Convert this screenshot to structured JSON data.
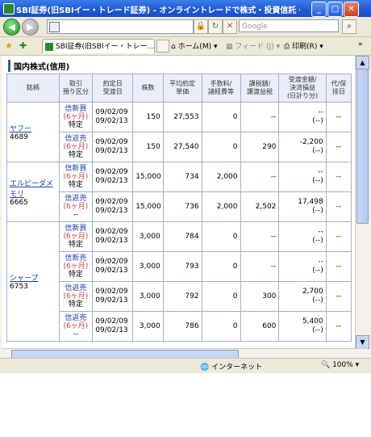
{
  "window": {
    "title": "SBI証券(旧SBIイー・トレード証券) - オンライントレードで株式・投資信託・債券を - - Wi...",
    "min": "_",
    "max": "□",
    "close": "✕"
  },
  "nav": {
    "back": "◀",
    "forward": "▶",
    "address_value": "",
    "search_placeholder": "Google"
  },
  "tab": {
    "label": "SBI証券(旧SBIイー・トレー..."
  },
  "toolbar": {
    "home": "ホーム(M)",
    "feed": "フィード (J)",
    "print": "印刷(R)"
  },
  "section_title": "国内株式(信用)",
  "table": {
    "headers": {
      "name": "銘柄",
      "trade": "取引\n預り区分",
      "date": "約定日\n受渡日",
      "qty": "株数",
      "price": "平均約定\n単価",
      "fee": "手数料/\n諸経費等",
      "tax": "課税額/\n譲渡益税",
      "amount": "受渡金額/\n決済損益\n(日計り分)",
      "other": "代/保\n排日"
    },
    "rows": [
      {
        "name": "ヤフー",
        "code": "4689",
        "trade1": "信新買",
        "trade2": "(6ヶ月)",
        "trade3": "特定",
        "date1": "09/02/09",
        "date2": "09/02/13",
        "qty": "150",
        "price": "27,553",
        "fee": "0",
        "tax": "--",
        "amount1": "--",
        "amount2": "(--)",
        "other": "--"
      },
      {
        "name": "",
        "code": "",
        "trade1": "信返売",
        "trade2": "(6ヶ月)",
        "trade3": "特定",
        "date1": "09/02/09",
        "date2": "09/02/13",
        "qty": "150",
        "price": "27,540",
        "fee": "0",
        "tax": "290",
        "amount1": "-2,200",
        "amount2": "(--)",
        "other": "--"
      },
      {
        "name": "エルピーダメモリ",
        "code": "6665",
        "trade1": "信新買",
        "trade2": "(6ヶ月)",
        "trade3": "特定",
        "date1": "09/02/09",
        "date2": "09/02/13",
        "qty": "15,000",
        "price": "734",
        "fee": "2,000",
        "tax": "--",
        "amount1": "--",
        "amount2": "(--)",
        "other": "--"
      },
      {
        "name": "",
        "code": "",
        "trade1": "信返売",
        "trade2": "(6ヶ月)",
        "trade3": "--",
        "date1": "09/02/09",
        "date2": "09/02/13",
        "qty": "15,000",
        "price": "736",
        "fee": "2,000",
        "tax": "2,502",
        "amount1": "17,498",
        "amount2": "(--)",
        "other": "--"
      },
      {
        "name": "シャープ",
        "code": "6753",
        "trade1": "信新買",
        "trade2": "(6ヶ月)",
        "trade3": "特定",
        "date1": "09/02/09",
        "date2": "09/02/13",
        "qty": "3,000",
        "price": "784",
        "fee": "0",
        "tax": "--",
        "amount1": "--",
        "amount2": "(--)",
        "other": "--"
      },
      {
        "name": "",
        "code": "",
        "trade1": "信新売",
        "trade2": "(6ヶ月)",
        "trade3": "特定",
        "date1": "09/02/09",
        "date2": "09/02/13",
        "qty": "3,000",
        "price": "793",
        "fee": "0",
        "tax": "--",
        "amount1": "--",
        "amount2": "(--)",
        "other": "--"
      },
      {
        "name": "",
        "code": "",
        "trade1": "信返売",
        "trade2": "(6ヶ月)",
        "trade3": "特定",
        "date1": "09/02/09",
        "date2": "09/02/13",
        "qty": "3,000",
        "price": "792",
        "fee": "0",
        "tax": "300",
        "amount1": "2,700",
        "amount2": "(--)",
        "other": "--"
      },
      {
        "name": "",
        "code": "",
        "trade1": "信返売",
        "trade2": "(6ヶ月)",
        "trade3": "--",
        "date1": "09/02/09",
        "date2": "09/02/13",
        "qty": "3,000",
        "price": "786",
        "fee": "0",
        "tax": "600",
        "amount1": "5,400",
        "amount2": "(--)",
        "other": "--"
      }
    ]
  },
  "status": {
    "zone": "インターネット",
    "zoom": "100%"
  },
  "colors": {
    "titlebar": "#1e57d4",
    "header_bg": "#e9eef8",
    "link": "#1a3cb0",
    "trade_red": "#cc4444"
  }
}
